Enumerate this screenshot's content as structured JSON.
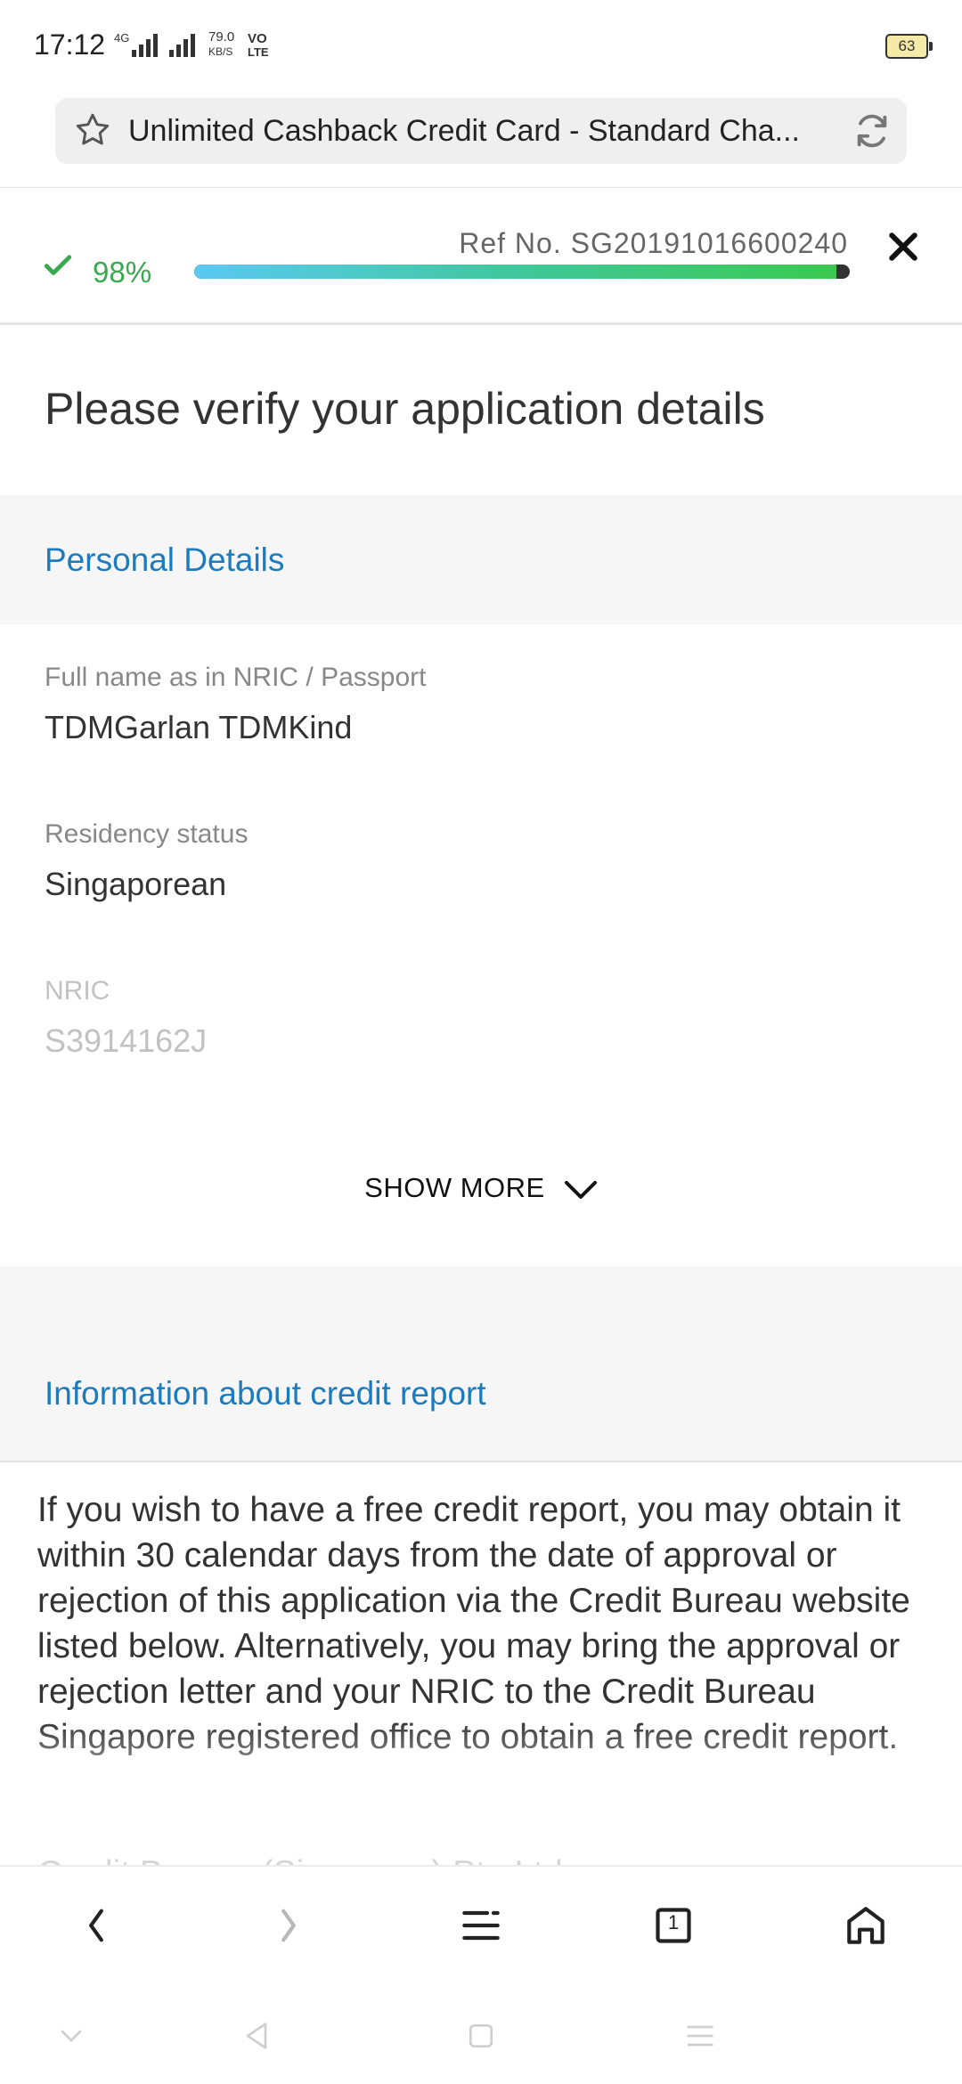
{
  "status_bar": {
    "time": "17:12",
    "network": "4G",
    "speed_value": "79.0",
    "speed_unit": "KB/S",
    "volte_top": "VO",
    "volte_bottom": "LTE",
    "battery": "63"
  },
  "browser": {
    "page_title": "Unlimited Cashback Credit Card - Standard Cha..."
  },
  "progress": {
    "percent_label": "98%",
    "percent_value": 0.98,
    "ref": "Ref No. SG20191016600240"
  },
  "page": {
    "heading": "Please verify your application details"
  },
  "personal_details": {
    "header": "Personal Details",
    "fields": [
      {
        "label": "Full name as in NRIC / Passport",
        "value": "TDMGarlan TDMKind"
      },
      {
        "label": "Residency status",
        "value": "Singaporean"
      },
      {
        "label": "NRIC",
        "value": "S3914162J"
      }
    ],
    "show_more": "SHOW MORE"
  },
  "credit_report": {
    "header": "Information about credit report",
    "body": "If you wish to have a free credit report, you may obtain it within 30 calendar days from the date of approval or rejection of this application via the Credit Bureau website listed below. Alternatively, you may bring the approval or rejection letter and your NRIC to the Credit Bureau Singapore registered office to obtain a free credit report.",
    "next_line_partial": "Credit Bureau (Singapore) Pte Ltd"
  },
  "nav": {
    "tab_count": "1"
  },
  "colors": {
    "accent_blue": "#1b7bbf",
    "success_green": "#38a94e",
    "section_bg": "#f6f6f7"
  }
}
